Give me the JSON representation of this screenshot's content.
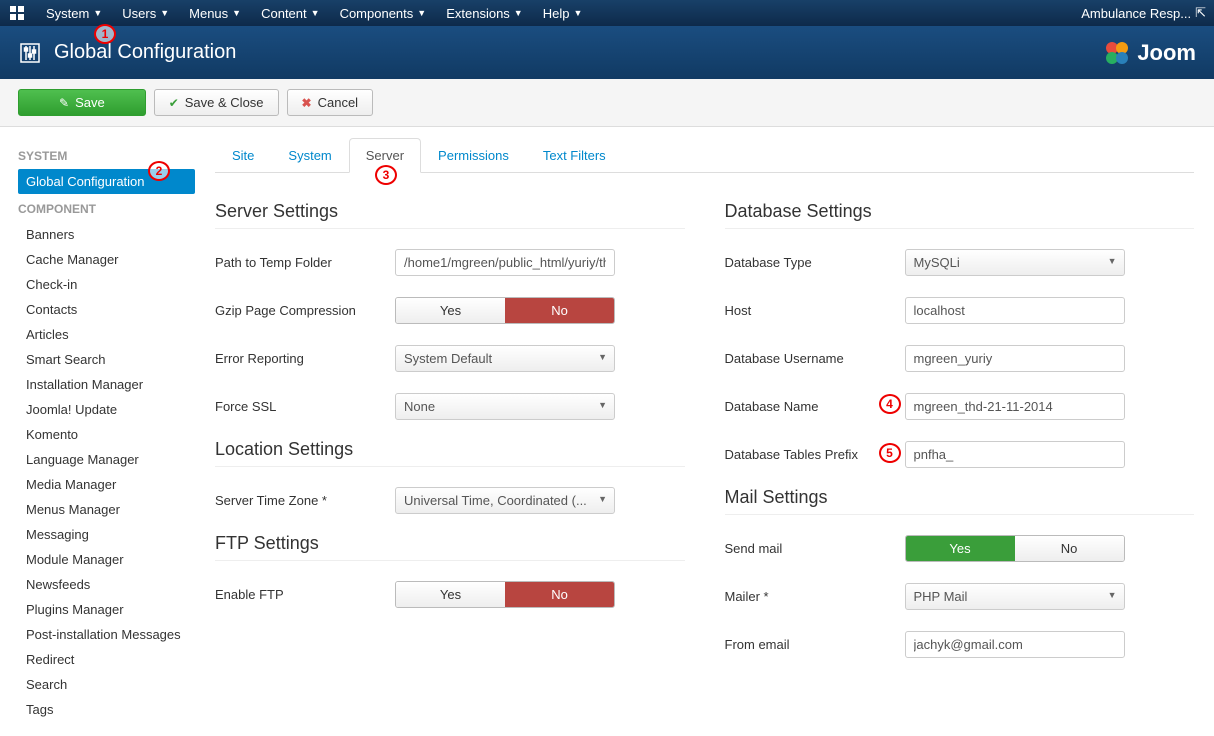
{
  "topnav": {
    "items": [
      "System",
      "Users",
      "Menus",
      "Content",
      "Components",
      "Extensions",
      "Help"
    ],
    "right_label": "Ambulance Resp...",
    "right_icon": "external-link-icon"
  },
  "header": {
    "title": "Global Configuration",
    "logo_text": "Joom"
  },
  "toolbar": {
    "save": "Save",
    "save_close": "Save & Close",
    "cancel": "Cancel"
  },
  "sidebar": {
    "groups": [
      {
        "label": "SYSTEM",
        "items": [
          "Global Configuration"
        ],
        "active_index": 0
      },
      {
        "label": "COMPONENT",
        "items": [
          "Banners",
          "Cache Manager",
          "Check-in",
          "Contacts",
          "Articles",
          "Smart Search",
          "Installation Manager",
          "Joomla! Update",
          "Komento",
          "Language Manager",
          "Media Manager",
          "Menus Manager",
          "Messaging",
          "Module Manager",
          "Newsfeeds",
          "Plugins Manager",
          "Post-installation Messages",
          "Redirect",
          "Search",
          "Tags"
        ]
      }
    ]
  },
  "tabs": {
    "items": [
      "Site",
      "System",
      "Server",
      "Permissions",
      "Text Filters"
    ],
    "active_index": 2
  },
  "server": {
    "heading": "Server Settings",
    "temp_path": {
      "label": "Path to Temp Folder",
      "value": "/home1/mgreen/public_html/yuriy/th"
    },
    "gzip": {
      "label": "Gzip Page Compression",
      "yes": "Yes",
      "no": "No",
      "value": "No"
    },
    "error_reporting": {
      "label": "Error Reporting",
      "value": "System Default"
    },
    "force_ssl": {
      "label": "Force SSL",
      "value": "None"
    }
  },
  "location": {
    "heading": "Location Settings",
    "timezone": {
      "label": "Server Time Zone *",
      "value": "Universal Time, Coordinated (..."
    }
  },
  "ftp": {
    "heading": "FTP Settings",
    "enable": {
      "label": "Enable FTP",
      "yes": "Yes",
      "no": "No",
      "value": "No"
    }
  },
  "database": {
    "heading": "Database Settings",
    "type": {
      "label": "Database Type",
      "value": "MySQLi"
    },
    "host": {
      "label": "Host",
      "value": "localhost"
    },
    "username": {
      "label": "Database Username",
      "value": "mgreen_yuriy"
    },
    "name": {
      "label": "Database Name",
      "value": "mgreen_thd-21-11-2014"
    },
    "prefix": {
      "label": "Database Tables Prefix",
      "value": "pnfha_"
    }
  },
  "mail": {
    "heading": "Mail Settings",
    "send": {
      "label": "Send mail",
      "yes": "Yes",
      "no": "No",
      "value": "Yes"
    },
    "mailer": {
      "label": "Mailer *",
      "value": "PHP Mail"
    },
    "from_email": {
      "label": "From email",
      "value": "jachyk@gmail.com"
    }
  },
  "annotations": {
    "a1": "1",
    "a2": "2",
    "a3": "3",
    "a4": "4",
    "a5": "5"
  }
}
